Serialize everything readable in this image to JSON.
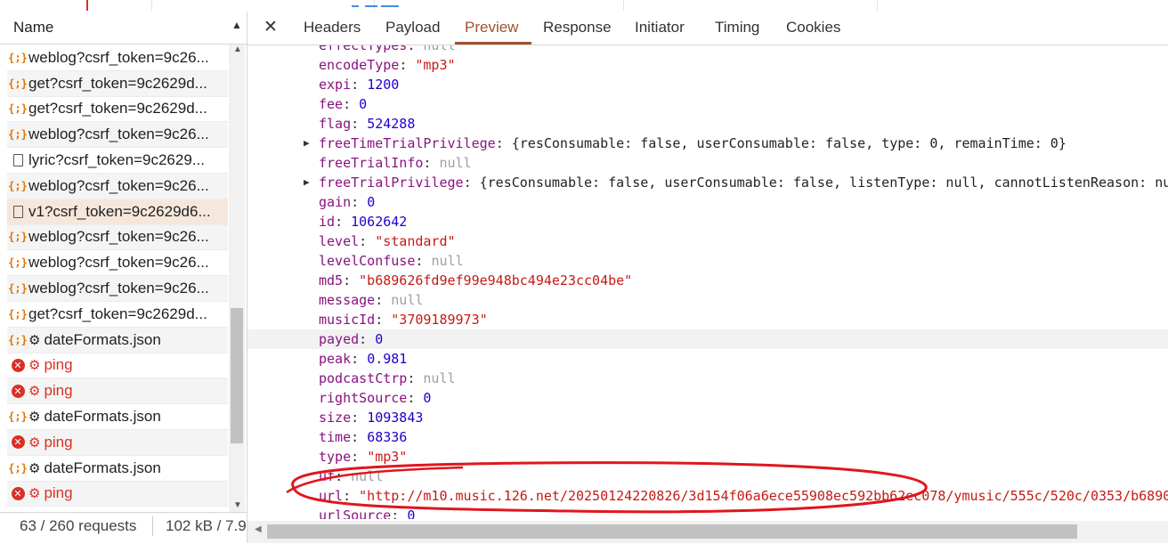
{
  "left_panel": {
    "header": {
      "name_label": "Name",
      "sort_indicator": "▲"
    },
    "rows": [
      {
        "icon": "json-icon",
        "name": "weblog?csrf_token=9c26...",
        "state": "normal"
      },
      {
        "icon": "json-icon",
        "name": "get?csrf_token=9c2629d...",
        "state": "alt"
      },
      {
        "icon": "json-icon",
        "name": "get?csrf_token=9c2629d...",
        "state": "normal"
      },
      {
        "icon": "json-icon",
        "name": "weblog?csrf_token=9c26...",
        "state": "alt"
      },
      {
        "icon": "document-icon",
        "name": "lyric?csrf_token=9c2629...",
        "state": "normal"
      },
      {
        "icon": "json-icon",
        "name": "weblog?csrf_token=9c26...",
        "state": "alt"
      },
      {
        "icon": "document-icon",
        "name": "v1?csrf_token=9c2629d6...",
        "state": "selected"
      },
      {
        "icon": "json-icon",
        "name": "weblog?csrf_token=9c26...",
        "state": "alt"
      },
      {
        "icon": "json-icon",
        "name": "weblog?csrf_token=9c26...",
        "state": "normal"
      },
      {
        "icon": "json-icon",
        "name": "weblog?csrf_token=9c26...",
        "state": "alt"
      },
      {
        "icon": "json-icon",
        "name": "get?csrf_token=9c2629d...",
        "state": "normal"
      },
      {
        "icon": "json-icon",
        "name": "dateFormats.json",
        "state": "alt",
        "service_worker": true
      },
      {
        "icon": "error-icon",
        "name": "ping",
        "state": "error",
        "service_worker": true
      },
      {
        "icon": "error-icon",
        "name": "ping",
        "state": "error-alt",
        "service_worker": true
      },
      {
        "icon": "json-icon",
        "name": "dateFormats.json",
        "state": "normal",
        "service_worker": true
      },
      {
        "icon": "error-icon",
        "name": "ping",
        "state": "error-alt",
        "service_worker": true
      },
      {
        "icon": "json-icon",
        "name": "dateFormats.json",
        "state": "normal",
        "service_worker": true
      },
      {
        "icon": "error-icon",
        "name": "ping",
        "state": "error-alt",
        "service_worker": true
      }
    ],
    "status": {
      "requests": "63 / 260 requests",
      "size": "102 kB / 7.9"
    }
  },
  "tabs": [
    {
      "label": "Headers",
      "active": false
    },
    {
      "label": "Payload",
      "active": false
    },
    {
      "label": "Preview",
      "active": true
    },
    {
      "label": "Response",
      "active": false
    },
    {
      "label": "Initiator",
      "active": false
    },
    {
      "label": "Timing",
      "active": false
    },
    {
      "label": "Cookies",
      "active": false
    }
  ],
  "preview": {
    "lines": [
      {
        "key": "effectTypes",
        "value": "null",
        "type": "null",
        "cut": true
      },
      {
        "key": "encodeType",
        "value": "\"mp3\"",
        "type": "string"
      },
      {
        "key": "expi",
        "value": "1200",
        "type": "number"
      },
      {
        "key": "fee",
        "value": "0",
        "type": "number"
      },
      {
        "key": "flag",
        "value": "524288",
        "type": "number"
      },
      {
        "key": "freeTimeTrialPrivilege",
        "value": "{resConsumable: false, userConsumable: false, type: 0, remainTime: 0}",
        "type": "object",
        "expandable": true
      },
      {
        "key": "freeTrialInfo",
        "value": "null",
        "type": "null"
      },
      {
        "key": "freeTrialPrivilege",
        "value": "{resConsumable: false, userConsumable: false, listenType: null, cannotListenReason: nu",
        "type": "object",
        "expandable": true
      },
      {
        "key": "gain",
        "value": "0",
        "type": "number"
      },
      {
        "key": "id",
        "value": "1062642",
        "type": "number"
      },
      {
        "key": "level",
        "value": "\"standard\"",
        "type": "string"
      },
      {
        "key": "levelConfuse",
        "value": "null",
        "type": "null"
      },
      {
        "key": "md5",
        "value": "\"b689626fd9ef99e948bc494e23cc04be\"",
        "type": "string"
      },
      {
        "key": "message",
        "value": "null",
        "type": "null"
      },
      {
        "key": "musicId",
        "value": "\"3709189973\"",
        "type": "string"
      },
      {
        "key": "payed",
        "value": "0",
        "type": "number",
        "highlight": true
      },
      {
        "key": "peak",
        "value": "0.981",
        "type": "number"
      },
      {
        "key": "podcastCtrp",
        "value": "null",
        "type": "null"
      },
      {
        "key": "rightSource",
        "value": "0",
        "type": "number"
      },
      {
        "key": "size",
        "value": "1093843",
        "type": "number"
      },
      {
        "key": "time",
        "value": "68336",
        "type": "number"
      },
      {
        "key": "type",
        "value": "\"mp3\"",
        "type": "string"
      },
      {
        "key": "uf",
        "value": "null",
        "type": "null"
      },
      {
        "key": "url",
        "value": "\"http://m10.music.126.net/20250124220826/3d154f06a6ece55908ec592bb62ec078/ymusic/555c/520c/0353/b6890",
        "type": "string",
        "annotated": true
      },
      {
        "key": "urlSource",
        "value": "0",
        "type": "number"
      }
    ]
  },
  "colors": {
    "key": "#881280",
    "string": "#c41a16",
    "number": "#1c00cf",
    "null": "#9aa0a6",
    "active_tab": "#a0522d",
    "error": "#d93025",
    "annotation": "#e0161e"
  }
}
